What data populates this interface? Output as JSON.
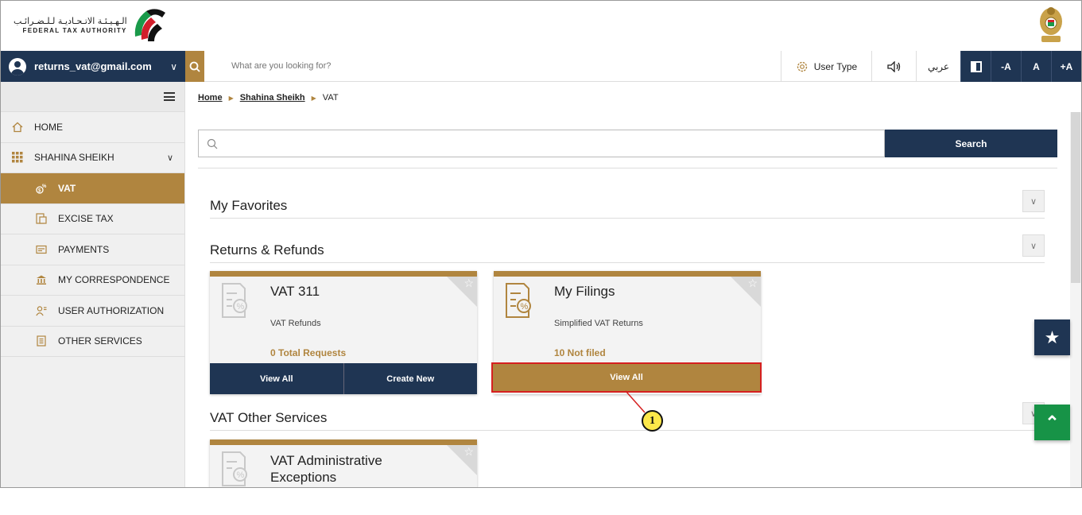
{
  "header": {
    "logo_ar": "الـهـيـئـة الاتـحـاديـة لـلـضـرائـب",
    "logo_en": "FEDERAL TAX AUTHORITY"
  },
  "topbar": {
    "user_email": "returns_vat@gmail.com",
    "search_placeholder": "What are you looking for?",
    "user_type": "User Type",
    "language": "عربي",
    "font_decrease": "-A",
    "font_normal": "A",
    "font_increase": "+A"
  },
  "sidebar": {
    "items": [
      {
        "label": "HOME",
        "icon": "home-icon"
      },
      {
        "label": "SHAHINA SHEIKH",
        "icon": "grid-icon"
      },
      {
        "label": "VAT",
        "icon": "vat-icon"
      },
      {
        "label": "EXCISE TAX",
        "icon": "excise-icon"
      },
      {
        "label": "PAYMENTS",
        "icon": "payments-icon"
      },
      {
        "label": "MY CORRESPONDENCE",
        "icon": "bank-icon"
      },
      {
        "label": "USER AUTHORIZATION",
        "icon": "user-auth-icon"
      },
      {
        "label": "OTHER SERVICES",
        "icon": "document-icon"
      }
    ]
  },
  "breadcrumb": {
    "home": "Home",
    "user": "Shahina Sheikh",
    "current": "VAT"
  },
  "main_search": {
    "button": "Search"
  },
  "sections": {
    "favorites": "My Favorites",
    "returns": "Returns & Refunds",
    "other": "VAT Other Services"
  },
  "cards": {
    "vat311": {
      "title": "VAT 311",
      "subtitle": "VAT Refunds",
      "count": "0 Total Requests",
      "action1": "View All",
      "action2": "Create New"
    },
    "filings": {
      "title": "My Filings",
      "subtitle": "Simplified VAT Returns",
      "count": "10 Not filed",
      "action1": "View All"
    },
    "admin": {
      "title_line1": "VAT Administrative",
      "title_line2": "Exceptions"
    }
  },
  "callout": {
    "number": "1"
  },
  "colors": {
    "navy": "#1f3553",
    "gold": "#b0853f",
    "green": "#179347",
    "highlight": "#d62020"
  }
}
